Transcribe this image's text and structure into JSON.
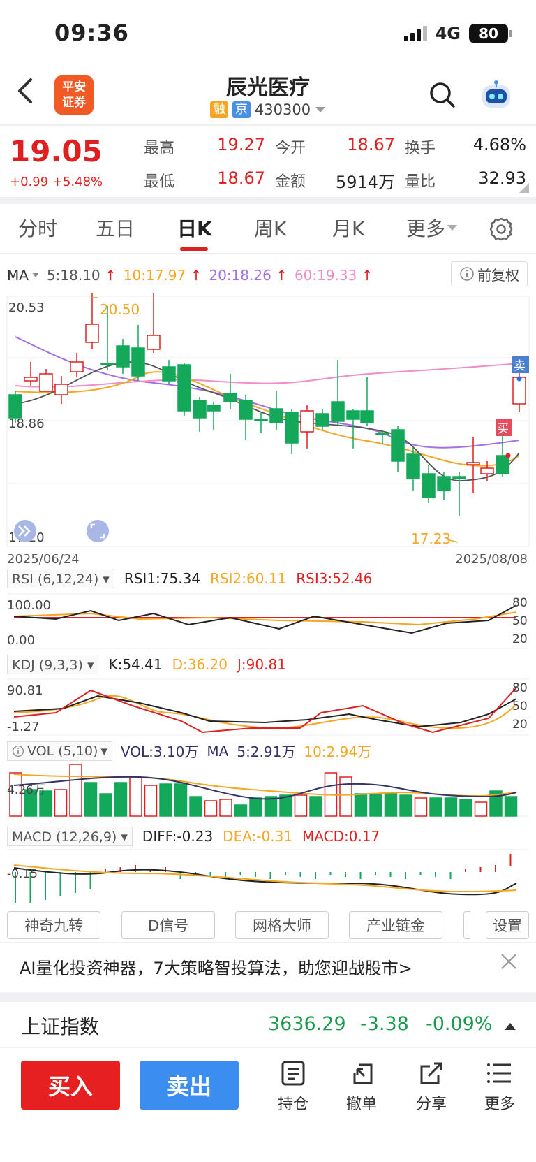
{
  "status": {
    "time": "09:36",
    "network": "4G",
    "battery": "80"
  },
  "header": {
    "broker_logo": "平安证券",
    "title": "辰光医疗",
    "tags": [
      {
        "text": "融",
        "color": "#f5a623"
      },
      {
        "text": "京",
        "color": "#4a90e2"
      }
    ],
    "code": "430300"
  },
  "quote": {
    "price": "19.05",
    "change": "+0.99 +5.48%",
    "stats": [
      {
        "label": "最高",
        "value": "19.27",
        "color": "#e02020"
      },
      {
        "label": "今开",
        "value": "18.67",
        "color": "#e02020"
      },
      {
        "label": "换手",
        "value": "4.68%",
        "color": "#222222"
      },
      {
        "label": "最低",
        "value": "18.67",
        "color": "#e02020"
      },
      {
        "label": "金额",
        "value": "5914万",
        "color": "#222222"
      },
      {
        "label": "量比",
        "value": "32.93",
        "color": "#222222"
      }
    ]
  },
  "tabs": [
    "分时",
    "五日",
    "日K",
    "周K",
    "月K",
    "更多"
  ],
  "active_tab": "日K",
  "ma": {
    "label": "MA",
    "items": [
      {
        "text": "5:18.10",
        "color": "#555555"
      },
      {
        "text": "10:17.97",
        "color": "#f5a623"
      },
      {
        "text": "20:18.26",
        "color": "#a66fe0"
      },
      {
        "text": "60:19.33",
        "color": "#f08cc8"
      }
    ],
    "fq": "前复权"
  },
  "kline": {
    "y_top": "20.53",
    "y_mid": "18.86",
    "y_bottom": "17.20",
    "high_label": "20.50",
    "low_label": "17.23",
    "date_start": "2025/06/24",
    "date_end": "2025/08/08",
    "sell_tag": "卖",
    "buy_tag": "买"
  },
  "rsi": {
    "selector": "RSI (6,12,24)",
    "values": [
      {
        "text": "RSI1:75.34",
        "color": "#222222"
      },
      {
        "text": "RSI2:60.11",
        "color": "#f5a623"
      },
      {
        "text": "RSI3:52.46",
        "color": "#e02020"
      }
    ],
    "y_top": "100.00",
    "y_bottom": "0.00",
    "levels": [
      "80",
      "50",
      "20"
    ]
  },
  "kdj": {
    "selector": "KDJ (9,3,3)",
    "values": [
      {
        "text": "K:54.41",
        "color": "#222222"
      },
      {
        "text": "D:36.20",
        "color": "#f5a623"
      },
      {
        "text": "J:90.81",
        "color": "#e02020"
      }
    ],
    "y_top": "90.81",
    "y_bottom": "-1.27",
    "levels": [
      "80",
      "50",
      "20"
    ]
  },
  "vol": {
    "selector": "VOL (5,10)",
    "values": [
      {
        "text": "VOL:3.10万",
        "color": "#333366"
      },
      {
        "text": "MA",
        "color": "#333366"
      },
      {
        "text": "5:2.91万",
        "color": "#333366"
      },
      {
        "text": "10:2.94万",
        "color": "#f5a623"
      }
    ],
    "y_label": "4.26万"
  },
  "macd": {
    "selector": "MACD (12,26,9)",
    "values": [
      {
        "text": "DIFF:-0.23",
        "color": "#222222"
      },
      {
        "text": "DEA:-0.31",
        "color": "#f5a623"
      },
      {
        "text": "MACD:0.17",
        "color": "#e02020"
      }
    ],
    "y_label": "-0.15"
  },
  "tools": [
    "神奇九转",
    "D信号",
    "网格大师",
    "产业链金",
    "设置"
  ],
  "ai_banner": "AI量化投资神器，7大策略智投算法，助您迎战股市>",
  "index": {
    "name": "上证指数",
    "value": "3636.29",
    "change": "-3.38",
    "pct": "-0.09%"
  },
  "bottom": {
    "buy": "买入",
    "sell": "卖出",
    "items": [
      {
        "label": "持仓",
        "icon": "holdings-icon"
      },
      {
        "label": "撤单",
        "icon": "cancel-order-icon"
      },
      {
        "label": "分享",
        "icon": "share-icon"
      },
      {
        "label": "更多",
        "icon": "more-icon"
      }
    ]
  }
}
